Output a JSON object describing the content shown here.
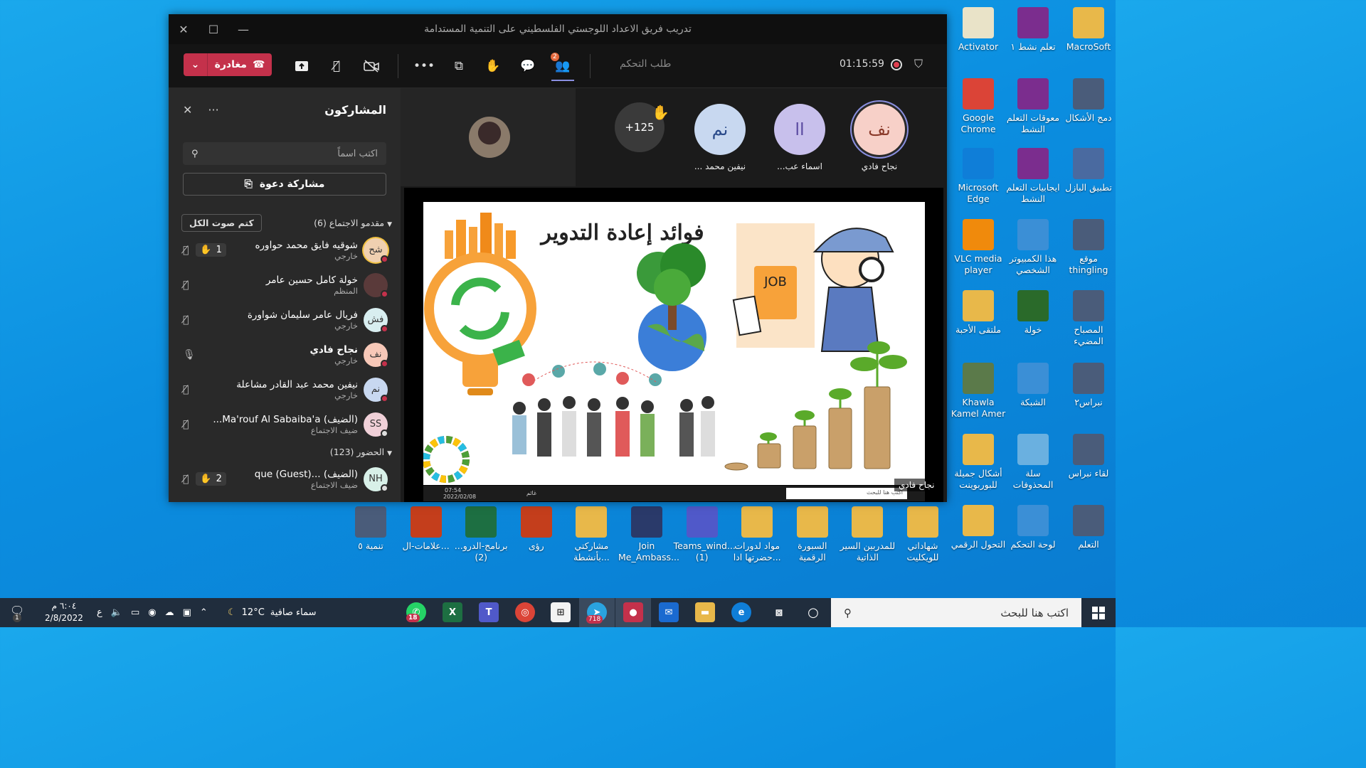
{
  "window": {
    "title": "تدريب فريق الاعداد اللوجستي الفلسطيني على التنمية المستدامة"
  },
  "toolbar": {
    "leave_label": "مغادرة",
    "control_request": "طلب التحكم",
    "timer": "01:15:59",
    "participants_badge": "2"
  },
  "panel": {
    "title": "المشاركون",
    "search_placeholder": "اكتب اسماً",
    "invite_label": "مشاركة دعوة",
    "presenters_header": "مقدمو الاجتماع (6)",
    "mute_all_label": "كتم صوت الكل",
    "attendees_header": "الحضور (123)",
    "presenters": [
      {
        "initials": "شح",
        "name": "شوقيه فايق محمد حواوره",
        "role": "خارجي",
        "hand": "1"
      },
      {
        "initials": "",
        "name": "خولة كامل حسين عامر",
        "role": "المنظم"
      },
      {
        "initials": "فش",
        "name": "فريال عامر سليمان شواورة",
        "role": "خارجي"
      },
      {
        "initials": "نف",
        "name": "نجاح فادي",
        "role": "خارجي"
      },
      {
        "initials": "نم",
        "name": "نيفين محمد عبد القادر مشاعلة",
        "role": "خارجي"
      },
      {
        "initials": "SS",
        "name": "(الضيف) Ma'rouf Al Sabaiba'a...",
        "role": "ضيف الاجتماع"
      }
    ],
    "attendees": [
      {
        "initials": "NH",
        "name": "(الضيف) ...que (Guest)",
        "role": "ضيف الاجتماع",
        "hand": "2"
      }
    ]
  },
  "stage": {
    "tiles": [
      {
        "initials": "نف",
        "name": "نجاح فادي"
      },
      {
        "initials": "اا",
        "name": "اسماء عب..."
      },
      {
        "initials": "نم",
        "name": "نيفين محمد ..."
      },
      {
        "initials": "+125",
        "name": ""
      }
    ],
    "presenter_label": "نجاح فادي",
    "slide_title": "فوائد إعادة التدوير",
    "job_text": "JOB",
    "mini_taskbar": {
      "search": "اكتب هنا للبحث",
      "time": "07:54",
      "date": "2022/02/08",
      "weather": "غائم"
    }
  },
  "desktop_right": [
    {
      "label": "MacroSoft",
      "color": "#e8b84a"
    },
    {
      "label": "تعلم نشط ١",
      "color": "#7b2d8e"
    },
    {
      "label": "Activator",
      "color": "#e9e3c8"
    },
    {
      "label": "دمج الأشكال",
      "color": "#4a5c7a"
    },
    {
      "label": "معوقات التعلم النشط",
      "color": "#7b2d8e"
    },
    {
      "label": "Google Chrome",
      "color": "#db4437"
    },
    {
      "label": "تطبيق البازل",
      "color": "#4a6aa0"
    },
    {
      "label": "ايجابيات التعلم النشط",
      "color": "#7b2d8e"
    },
    {
      "label": "Microsoft Edge",
      "color": "#0f7ed8"
    },
    {
      "label": "موقع thingling",
      "color": "#4a5c7a"
    },
    {
      "label": "هذا الكمبيوتر الشخصي",
      "color": "#3b8fd6"
    },
    {
      "label": "VLC media player",
      "color": "#f08a0c"
    },
    {
      "label": "المصباح المضيء",
      "color": "#4a5c7a"
    },
    {
      "label": "خولة",
      "color": "#2a6a2a"
    },
    {
      "label": "ملتقى الأحبة",
      "color": "#e8b84a"
    },
    {
      "label": "نبراس٢",
      "color": "#4a5c7a"
    },
    {
      "label": "الشبكة",
      "color": "#3b8fd6"
    },
    {
      "label": "Khawla Kamel Amer",
      "color": "#5b7a4a"
    },
    {
      "label": "لقاء نبراس",
      "color": "#4a5c7a"
    },
    {
      "label": "سلة المحذوفات",
      "color": "#6ab0e0"
    },
    {
      "label": "أشكال جميلة للبوربوينت",
      "color": "#e8b84a"
    },
    {
      "label": "التعلم",
      "color": "#4a5c7a"
    },
    {
      "label": "لوحة التحكم",
      "color": "#3b8fd6"
    },
    {
      "label": "التحول الرقمي",
      "color": "#e8b84a"
    }
  ],
  "desktop_bottom": [
    {
      "label": "شهاداتي للويكليت",
      "color": "#e8b84a"
    },
    {
      "label": "للمدربين السير الذاتية",
      "color": "#e8b84a"
    },
    {
      "label": "السبورة الرقمية",
      "color": "#e8b84a"
    },
    {
      "label": "مواد لدورات حضرتها ادا...",
      "color": "#e8b84a"
    },
    {
      "label": "Teams_wind... (1)",
      "color": "#5059c9"
    },
    {
      "label": "Join Me_Ambass...",
      "color": "#2a3a6a"
    },
    {
      "label": "مشاركتي بأنشطة...",
      "color": "#e8b84a"
    },
    {
      "label": "رؤى",
      "color": "#c43e1c"
    },
    {
      "label": "برنامج-الدرو... (2)",
      "color": "#1d6f42"
    },
    {
      "label": "علامات-ال...",
      "color": "#c43e1c"
    },
    {
      "label": "تنمية ٥",
      "color": "#4a5c7a"
    }
  ],
  "taskbar": {
    "search_placeholder": "اكتب هنا للبحث",
    "weather": "سماء صافية",
    "temperature": "12°C",
    "time": "٦:٠٤ م",
    "date": "2/8/2022",
    "notif_count": "1",
    "whatsapp_badge": "18",
    "telegram_badge": "718",
    "lang": "ع"
  }
}
